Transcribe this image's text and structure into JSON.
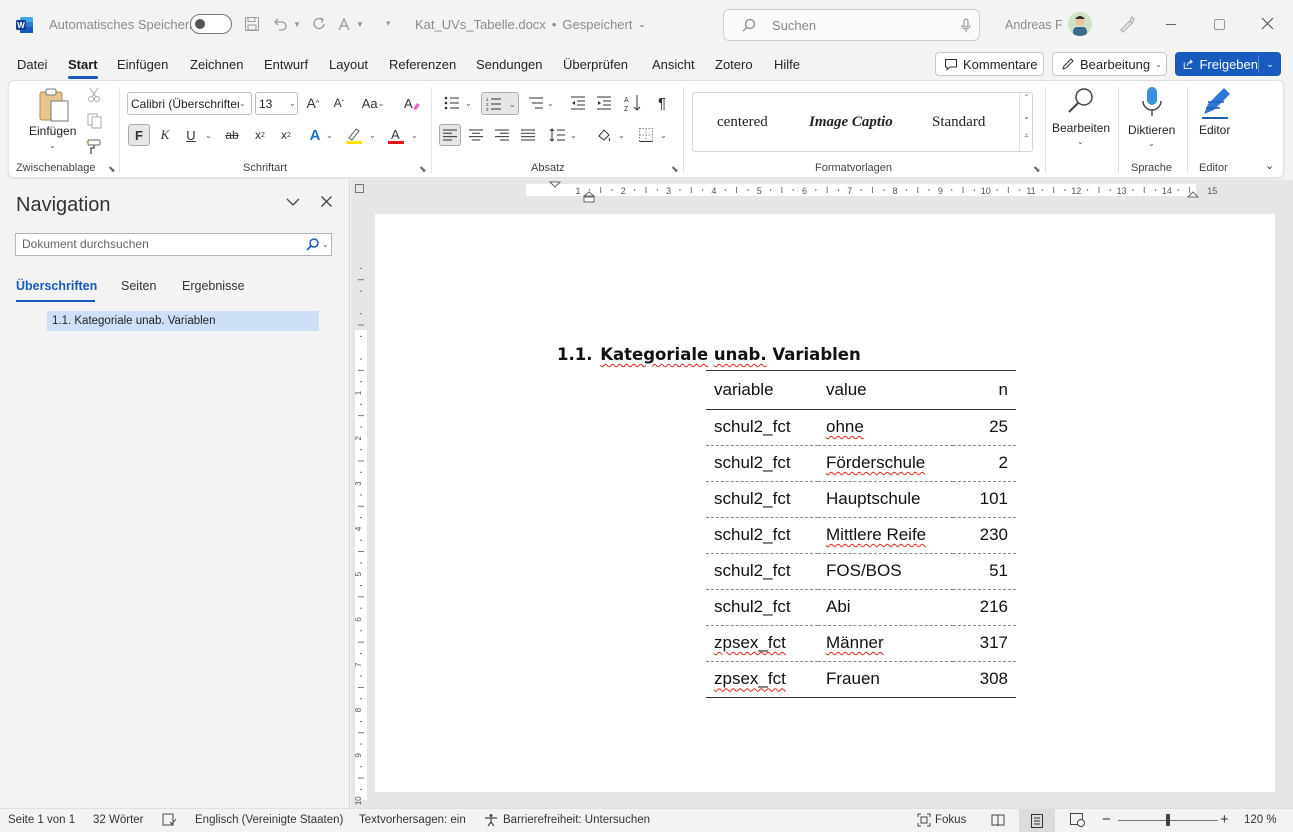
{
  "titlebar": {
    "autosave_label": "Automatisches Speichern",
    "doc_title": "Kat_UVs_Tabelle.docx",
    "save_state": "Gespeichert",
    "search_placeholder": "Suchen",
    "user_name": "Andreas F"
  },
  "menu": {
    "items": [
      "Datei",
      "Start",
      "Einfügen",
      "Zeichnen",
      "Entwurf",
      "Layout",
      "Referenzen",
      "Sendungen",
      "Überprüfen",
      "Ansicht",
      "Zotero",
      "Hilfe"
    ],
    "active": "Start",
    "comments_label": "Kommentare",
    "editing_label": "Bearbeitung",
    "share_label": "Freigeben"
  },
  "ribbon": {
    "paste_label": "Einfügen",
    "clipboard_label": "Zwischenablage",
    "font_name": "Calibri (Überschriften)",
    "font_size": "13",
    "font_label": "Schriftart",
    "bold": "F",
    "italic": "K",
    "underline": "U",
    "strike": "ab",
    "paragraph_label": "Absatz",
    "styles": [
      "centered",
      "Image Captio",
      "Standard"
    ],
    "styles_label": "Formatvorlagen",
    "edit_label": "Bearbeiten",
    "dictate_label": "Diktieren",
    "voice_label": "Sprache",
    "editor_btn_label": "Editor",
    "editor_label": "Editor"
  },
  "navigation": {
    "title": "Navigation",
    "search_placeholder": "Dokument durchsuchen",
    "tabs": [
      "Überschriften",
      "Seiten",
      "Ergebnisse"
    ],
    "active_tab": "Überschriften",
    "headings": [
      "1.1. Kategoriale unab. Variablen"
    ]
  },
  "ruler": {
    "h_marks": [
      "1",
      "2",
      "3",
      "4",
      "5",
      "6",
      "7",
      "8",
      "9",
      "10",
      "11",
      "12",
      "13",
      "14",
      "15"
    ],
    "v_marks": [
      "1",
      "2",
      "3",
      "4",
      "5",
      "6",
      "7",
      "8",
      "9",
      "10"
    ]
  },
  "document": {
    "heading_number": "1.1.",
    "heading_text": "Kategoriale unab. Variablen",
    "table": {
      "headers": [
        "variable",
        "value",
        "n"
      ],
      "rows": [
        [
          "schul2_fct",
          "ohne",
          "25"
        ],
        [
          "schul2_fct",
          "Förderschule",
          "2"
        ],
        [
          "schul2_fct",
          "Hauptschule",
          "101"
        ],
        [
          "schul2_fct",
          "Mittlere Reife",
          "230"
        ],
        [
          "schul2_fct",
          "FOS/BOS",
          "51"
        ],
        [
          "schul2_fct",
          "Abi",
          "216"
        ],
        [
          "zpsex_fct",
          "Männer",
          "317"
        ],
        [
          "zpsex_fct",
          "Frauen",
          "308"
        ]
      ]
    }
  },
  "status": {
    "page": "Seite 1 von 1",
    "words": "32 Wörter",
    "language": "Englisch (Vereinigte Staaten)",
    "predictions": "Textvorhersagen: ein",
    "accessibility": "Barrierefreiheit: Untersuchen",
    "focus": "Fokus",
    "zoom": "120 %"
  },
  "colors": {
    "accent": "#185abd",
    "word_blue": "#185abd",
    "nav_highlight": "#cde0f7"
  }
}
